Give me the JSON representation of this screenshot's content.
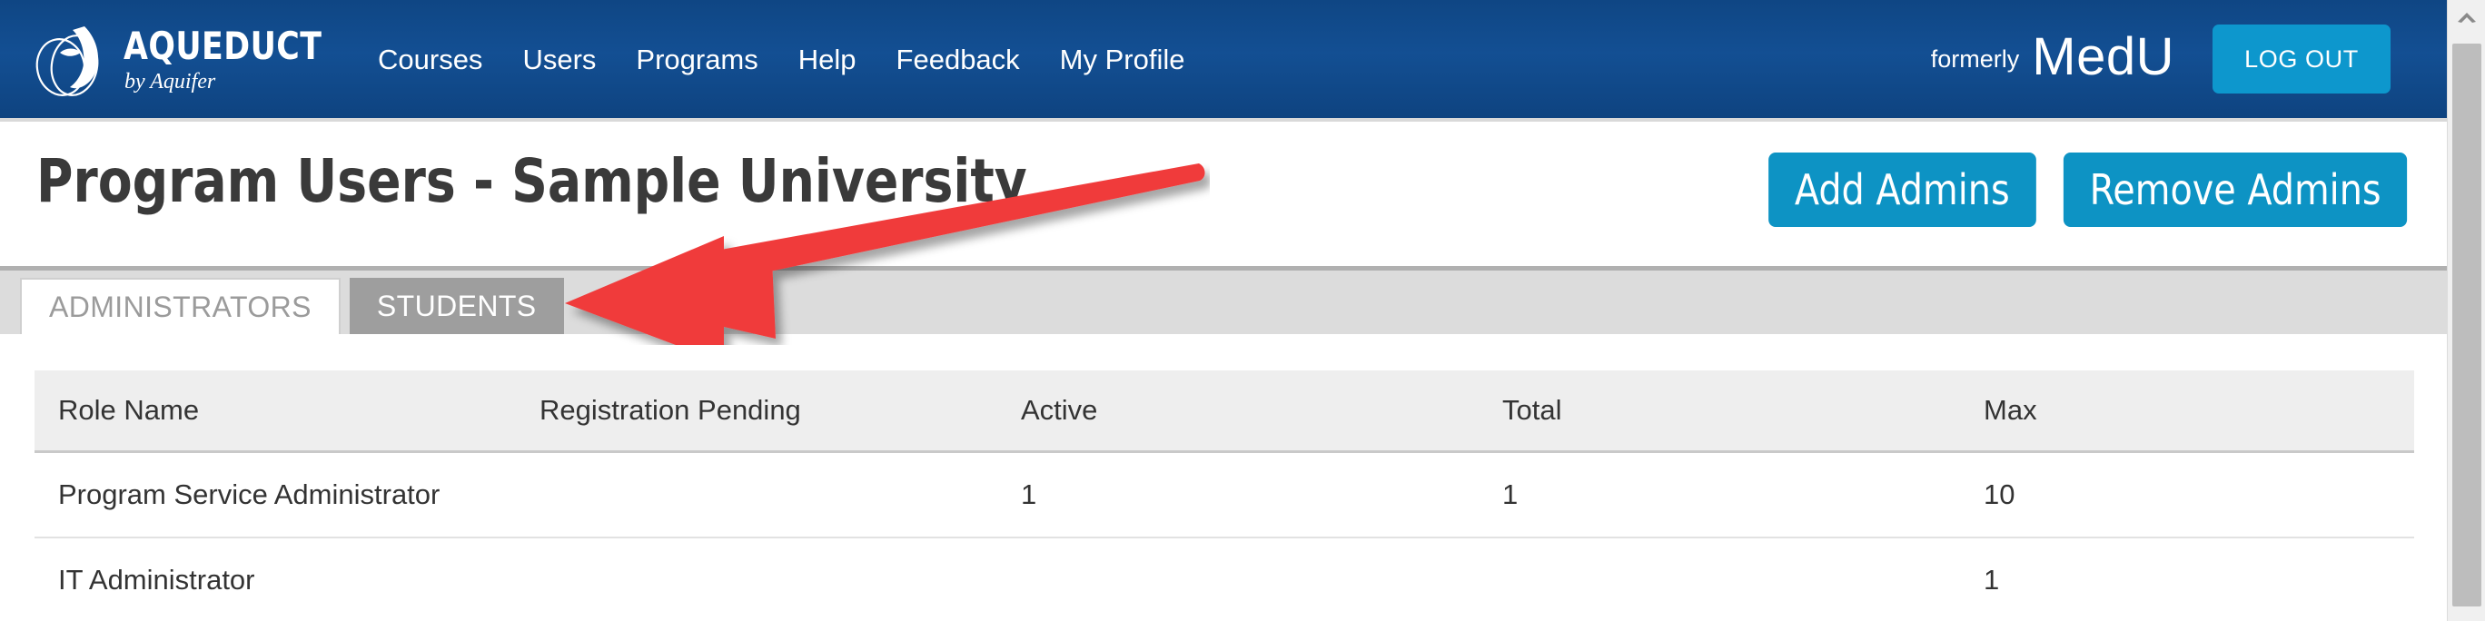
{
  "header": {
    "logo": {
      "mark": "aqueduct-droplet-logo",
      "title": "AQUEDUCT",
      "subtitle": "by Aquifer"
    },
    "nav": [
      {
        "label": "Courses"
      },
      {
        "label": "Users"
      },
      {
        "label": "Programs"
      },
      {
        "label": "Help"
      },
      {
        "label": "Feedback"
      },
      {
        "label": "My Profile"
      }
    ],
    "formerly_label": "formerly",
    "former_brand": "MedU",
    "logout_label": "LOG OUT",
    "bar_color": "#114a8a",
    "button_color": "#0d97cd"
  },
  "title_row": {
    "title": "Program Users - Sample University",
    "buttons": [
      {
        "label": "Add Admins"
      },
      {
        "label": "Remove Admins"
      }
    ],
    "button_color": "#0d93c4"
  },
  "tabs": [
    {
      "label": "ADMINISTRATORS",
      "active": true
    },
    {
      "label": "STUDENTS",
      "active": false
    }
  ],
  "table": {
    "columns": [
      "Role Name",
      "Registration Pending",
      "Active",
      "Total",
      "Max"
    ],
    "rows": [
      {
        "role_name": "Program Service Administrator",
        "registration_pending": "",
        "active": "1",
        "total": "1",
        "max": "10"
      },
      {
        "role_name": "IT Administrator",
        "registration_pending": "",
        "active": "",
        "total": "",
        "max": "1"
      }
    ]
  },
  "annotation": {
    "type": "red-arrow",
    "color": "#f03b3b",
    "points_to": "STUDENTS"
  },
  "scrollbar": {
    "up_arrow": "chevron-up-icon"
  }
}
